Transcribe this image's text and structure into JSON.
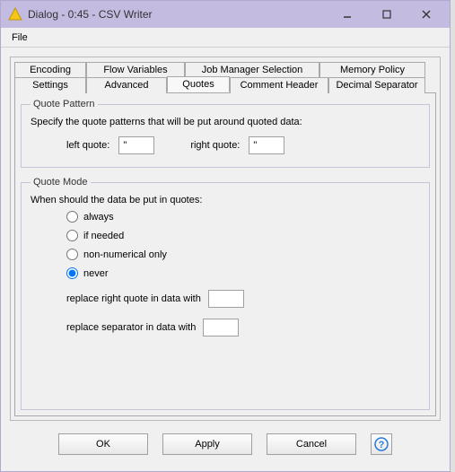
{
  "window": {
    "title": "Dialog - 0:45 - CSV Writer"
  },
  "menubar": {
    "file": "File"
  },
  "tabs": {
    "row1": [
      {
        "label": "Encoding"
      },
      {
        "label": "Flow Variables"
      },
      {
        "label": "Job Manager Selection"
      },
      {
        "label": "Memory Policy"
      }
    ],
    "row2": [
      {
        "label": "Settings"
      },
      {
        "label": "Advanced"
      },
      {
        "label": "Quotes"
      },
      {
        "label": "Comment Header"
      },
      {
        "label": "Decimal Separator"
      }
    ],
    "active": "Quotes"
  },
  "quotePattern": {
    "legend": "Quote Pattern",
    "desc": "Specify the quote patterns that will be put around quoted data:",
    "leftLabel": "left quote:",
    "leftValue": "\"",
    "rightLabel": "right quote:",
    "rightValue": "\""
  },
  "quoteMode": {
    "legend": "Quote Mode",
    "desc": "When should the data be put in quotes:",
    "options": [
      {
        "label": "always"
      },
      {
        "label": "if needed"
      },
      {
        "label": "non-numerical only"
      },
      {
        "label": "never"
      }
    ],
    "selected": "never",
    "replaceRightLabel": "replace right quote in data with",
    "replaceRightValue": "",
    "replaceSepLabel": "replace separator in data with",
    "replaceSepValue": ""
  },
  "buttons": {
    "ok": "OK",
    "apply": "Apply",
    "cancel": "Cancel"
  }
}
